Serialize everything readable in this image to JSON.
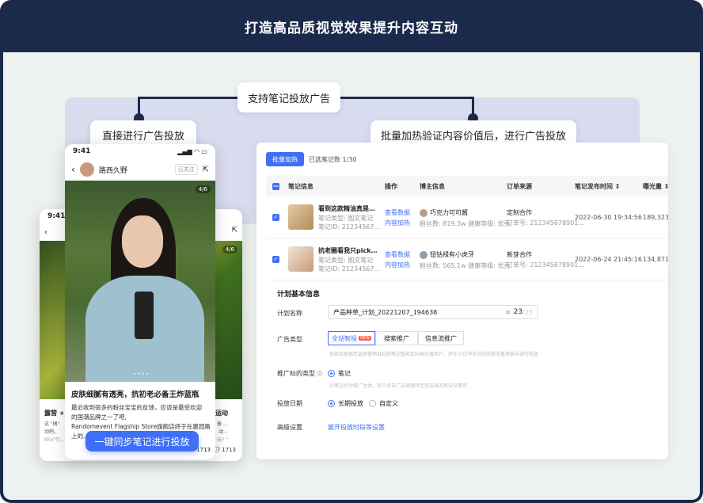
{
  "header": {
    "title": "打造高品质视觉效果提升内容互动"
  },
  "callouts": {
    "top": "支持笔记投放广告",
    "left": "直接进行广告投放",
    "right": "批量加热验证内容价值后，进行广告投放"
  },
  "phone_back": {
    "time": "9:41",
    "left_card_title": "露营 + S",
    "left_card_desc1": "这 \"搞\" ",
    "left_card_desc2": "动吧。",
    "left_card_desc3": "EEo\"行…",
    "right_card_title": "运动",
    "right_card_desc1": "备 …",
    "right_card_desc2": "动…",
    "right_card_desc3": "一玩? \"",
    "page_counter": "4/6",
    "comments": "1713"
  },
  "phone_front": {
    "time": "9:41",
    "user_name": "路西久野",
    "follow_label": "已关注",
    "page_counter": "4/6",
    "post_title": "皮肤细腻有透亮，抗初老必备王炸蓝瓶",
    "post_body_1": "最近收到很多的粉丝宝宝的反馈，应该是最受欢迎",
    "post_body_2": "的国潮品牌之一了吧,",
    "post_body_3": "Randomevent Flagship Store旗舰店终于在惠园路",
    "post_body_4": "上的…",
    "likes": "1713",
    "cta_label": "一键同步笔记进行投放"
  },
  "panel": {
    "batch_button": "批量加热",
    "selected_text": "已选笔记数 1/30",
    "columns": [
      "笔记信息",
      "操作",
      "博主信息",
      "订单来源",
      "笔记发布时间",
      "曝光量"
    ],
    "rows": [
      {
        "title": "看到这款精油真是…",
        "type": "笔记类型: 图文笔记",
        "id": "笔记ID: 21234567…",
        "action1": "查看数据",
        "action2": "内容加热",
        "blogger": "巧克力可可酱",
        "fans": "粉丝数: 819.3w",
        "level": "健康等级: 优秀",
        "source": "定制合作",
        "order": "订单号: 212345678901…",
        "date": "2022-06-30 19:34:56",
        "views": "189,323"
      },
      {
        "title": "抗老圈看我只pick…",
        "type": "笔记类型: 图文笔记",
        "id": "笔记ID: 21234567…",
        "action1": "查看数据",
        "action2": "内容加热",
        "blogger": "钮钴禄有小虎牙",
        "fans": "粉丝数: 565.1w",
        "level": "健康等级: 优秀",
        "source": "新芽合作",
        "order": "订单号: 212345678901…",
        "date": "2022-06-24 21:45:16",
        "views": "134,871"
      }
    ],
    "plan_title": "计划基本信息",
    "plan_name_label": "计划名称",
    "plan_name_value": "产品种草_计划_20221207_194638",
    "plan_name_count": "23",
    "plan_name_max": "/25",
    "ad_type_label": "广告类型",
    "ad_type_options": [
      "全站智投",
      "搜索推广",
      "信息流推广"
    ],
    "ad_type_new": "NEW",
    "ad_type_hint": "系统会根据您选择营销目标和笔记智能定向高价值用户，并在小红书全站的优质流量场景中进行投放",
    "target_label": "推广标的类型",
    "target_value": "笔记",
    "target_hint": "以笔记作为推广主体，用户点击广告将跳转至您选择的笔记详情页",
    "date_label": "投放日期",
    "date_options": [
      "长期投放",
      "自定义"
    ],
    "advanced_label": "高级设置",
    "advanced_link": "展开投放时段等设置"
  },
  "colors": {
    "navy": "#1b2a4a",
    "accent": "#3f6ff5",
    "stage": "#eef2ee"
  }
}
